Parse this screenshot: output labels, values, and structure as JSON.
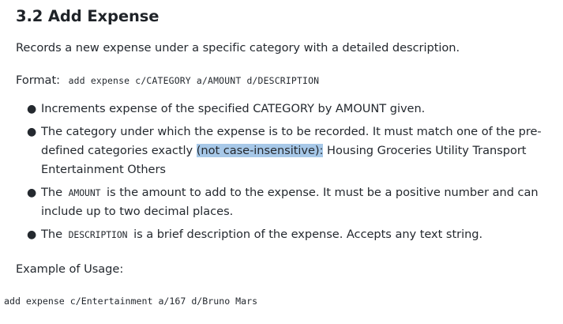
{
  "section": {
    "title": "3.2 Add Expense",
    "description": "Records a new expense under a specific category with a detailed description.",
    "format_label": "Format:",
    "format_code": "add expense c/CATEGORY a/AMOUNT d/DESCRIPTION",
    "bullets": {
      "b1": "Increments expense of the specified CATEGORY by AMOUNT given.",
      "b2_part1": "The category under which the expense is to be recorded. It must match one of the pre-",
      "b2_part2": "defined categories exactly",
      "b2_highlight": "(not case-insensitive):",
      "b2_part3": "Housing Groceries Utility Transport",
      "b2_part4": "Entertainment Others",
      "b3_prefix": "The",
      "b3_code": "AMOUNT",
      "b3_suffix_1": "is the amount to add to the expense. It must be a positive number and can",
      "b3_suffix_2": "include up to two decimal places.",
      "b4_prefix": "The",
      "b4_code": "DESCRIPTION",
      "b4_suffix": "is a brief description of the expense. Accepts any text string."
    },
    "example_label": "Example of Usage:",
    "example_code": "add expense c/Entertainment a/167 d/Bruno Mars"
  },
  "colors": {
    "text": "#24292f",
    "selection_highlight": "#a7c8e8"
  }
}
